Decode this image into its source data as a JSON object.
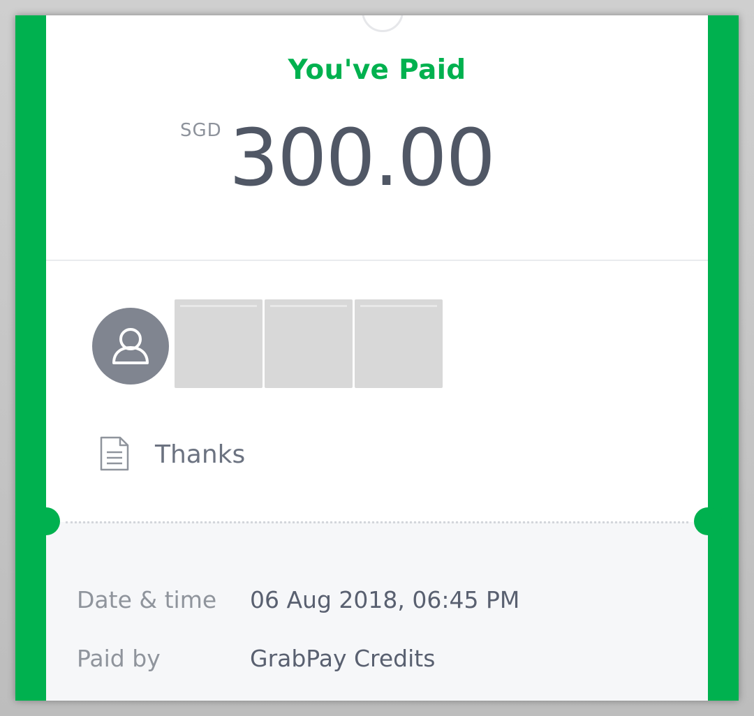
{
  "receipt": {
    "title": "You've Paid",
    "currency": "SGD",
    "amount": "300.00",
    "note": "Thanks"
  },
  "details": [
    {
      "label": "Date & time",
      "value": "06 Aug 2018, 06:45 PM"
    },
    {
      "label": "Paid by",
      "value": "GrabPay Credits"
    }
  ],
  "colors": {
    "accent": "#00b14f",
    "amount_text": "#505765",
    "avatar_bg": "#808590",
    "details_bg": "#f6f7f9"
  },
  "icons": {
    "avatar": "user-icon",
    "note": "document-icon"
  }
}
